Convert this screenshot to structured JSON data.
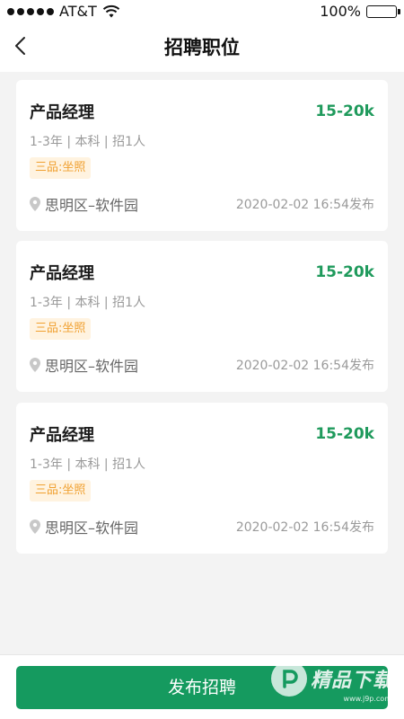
{
  "status_bar": {
    "carrier": "AT&T",
    "battery": "100%"
  },
  "nav": {
    "title": "招聘职位"
  },
  "jobs": [
    {
      "title": "产品经理",
      "salary": "15-20k",
      "meta": "1-3年 | 本科 | 招1人",
      "tag": "三品:坐照",
      "location": "思明区–软件园",
      "posted": "2020-02-02 16:54发布"
    },
    {
      "title": "产品经理",
      "salary": "15-20k",
      "meta": "1-3年 | 本科 | 招1人",
      "tag": "三品:坐照",
      "location": "思明区–软件园",
      "posted": "2020-02-02 16:54发布"
    },
    {
      "title": "产品经理",
      "salary": "15-20k",
      "meta": "1-3年 | 本科 | 招1人",
      "tag": "三品:坐照",
      "location": "思明区–软件园",
      "posted": "2020-02-02 16:54发布"
    }
  ],
  "footer": {
    "publish_label": "发布招聘",
    "watermark_text": "精品下载",
    "watermark_sub": "www.j9p.com"
  },
  "colors": {
    "accent": "#159a5f",
    "salary": "#1f9a5c",
    "tag_text": "#f0a030",
    "tag_bg": "#fff3e0"
  }
}
